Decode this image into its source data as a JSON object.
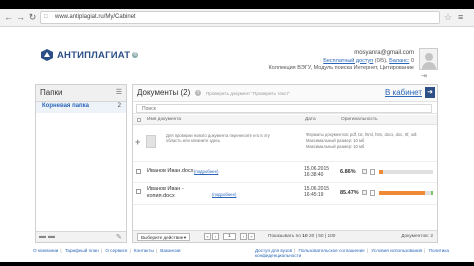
{
  "browser": {
    "url": "www.antiplagiat.ru/My/Cabinet",
    "nav": {
      "back": "←",
      "forward": "→",
      "reload": "↻",
      "star": "☆",
      "menu": "≡"
    }
  },
  "header": {
    "logo_text": "АНТИПЛАГИАТ",
    "logo_reg": "®",
    "user_email": "mosyanra@gmail.com",
    "plan_label": "Бесплатный доступ",
    "plan_count": "(0/5)",
    "balance_label": "Баланс:",
    "balance_value": "0",
    "collection_line": "Коллекция ВЭГУ, Модуль поиска Интернет, Цитирование"
  },
  "sidebar": {
    "title": "Папки",
    "items": [
      {
        "label": "Корневая папка",
        "count": "2"
      }
    ]
  },
  "main": {
    "title": "Документы",
    "count": "(2)",
    "help": "?",
    "check_link": "Проверить документ \"Проверить текст\"",
    "cabinet_link": "В кабинет",
    "search_placeholder": "Поиск",
    "columns": {
      "name": "Имя документа",
      "date": "Дата",
      "originality": "Оригинальность"
    },
    "upload_text": "Для проверки нового документа перенесите его в эту область или кликните здесь",
    "formats_lines": [
      "Форматы документов: pdf, txt, html, htm, docx, doc, rtf, odt",
      "Максимальный размер: 10 мб",
      "Максимальный размер: 10 мб"
    ],
    "documents": [
      {
        "name": "Иванов Иван.docx",
        "link": "(подробнее)",
        "date": "15.06.2015",
        "time": "16:38:40",
        "originality": "6.86%",
        "orig_fraction": 0.0686,
        "green_fraction": 0.0
      },
      {
        "name_line1": "Иванов Иван -",
        "name_line2": "копия.docx",
        "link": "(подробнее)",
        "date": "15.06.2015",
        "time": "16:45:19",
        "originality": "85.47%",
        "orig_fraction": 0.8547,
        "green_fraction": 0.03
      }
    ],
    "toolbar": {
      "action_label": "Выберите действие",
      "page": "1",
      "per_page_label": "Показывать по",
      "per_page_value": "10",
      "per_page_options": "20 | 50 | 100",
      "docs_count": "Документов: 2"
    }
  },
  "footer": {
    "left_links": [
      "О компании",
      "Тарифный план",
      "О сервисе",
      "Контакты",
      "Вакансии"
    ],
    "right_links": [
      "Доступ для вузов",
      "Пользовательское соглашение",
      "Условия использования",
      "Политика конфиденциальности"
    ]
  },
  "colors": {
    "brand_blue": "#2c4f86",
    "link_blue": "#2a66b8",
    "bar_orange": "#f08a35",
    "bar_green": "#7fc36a"
  },
  "icons": {
    "logo": "antiplagiat-logo-icon",
    "avatar": "avatar-silhouette",
    "upload": "document-icon",
    "cabinet": "exit-arrow-icon"
  }
}
